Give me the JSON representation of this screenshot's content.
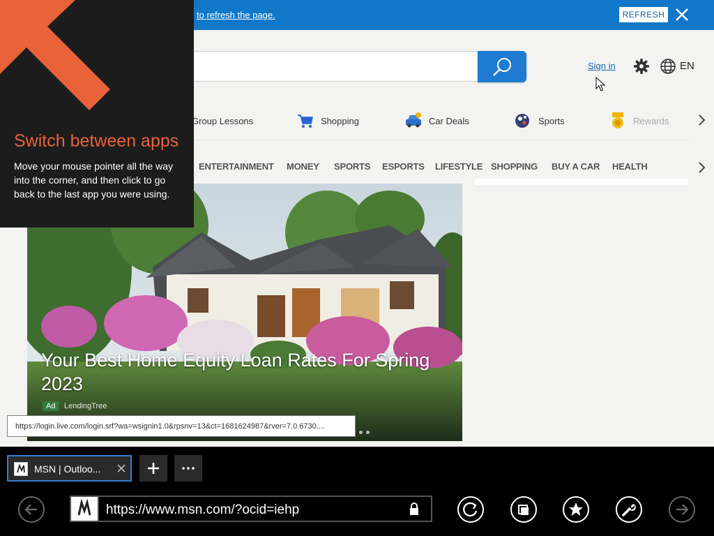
{
  "notification": {
    "message": "to refresh the page.",
    "refresh_label": "REFRESH"
  },
  "header": {
    "sign_in": "Sign in",
    "language": "EN",
    "icons": [
      "search-icon",
      "gear-icon",
      "globe-icon"
    ]
  },
  "quick_links": [
    {
      "label": "Group Lessons",
      "icon": "group-lessons-icon"
    },
    {
      "label": "Shopping",
      "icon": "shopping-cart-icon"
    },
    {
      "label": "Car Deals",
      "icon": "car-icon"
    },
    {
      "label": "Sports",
      "icon": "sports-ball-icon"
    },
    {
      "label": "Rewards",
      "icon": "rewards-medal-icon"
    }
  ],
  "nav": [
    "ENTERTAINMENT",
    "MONEY",
    "SPORTS",
    "ESPORTS",
    "LIFESTYLE",
    "SHOPPING",
    "BUY A CAR",
    "HEALTH"
  ],
  "hero": {
    "title": "Your Best Home Equity Loan Rates For Spring 2023",
    "badge": "Ad",
    "source": "LendingTree"
  },
  "status_tooltip": "https://login.live.com/login.srf?wa=wsignin1.0&rpsnv=13&ct=1681624987&rver=7.0.6730....",
  "charm_tip": {
    "title": "Switch between apps",
    "body": "Move your mouse pointer all the way into the corner, and then click to go back to the last app you were using.",
    "accent": "#e8623a"
  },
  "browser": {
    "tab_title": "MSN | Outloo...",
    "address": "https://www.msn.com/?ocid=iehp",
    "buttons": [
      "back-icon",
      "refresh-icon",
      "tabs-icon",
      "favorites-icon",
      "tools-icon",
      "forward-icon"
    ]
  },
  "colors": {
    "notification": "#1077c9",
    "search_button": "#1f7ad2",
    "link": "#1665b7"
  }
}
